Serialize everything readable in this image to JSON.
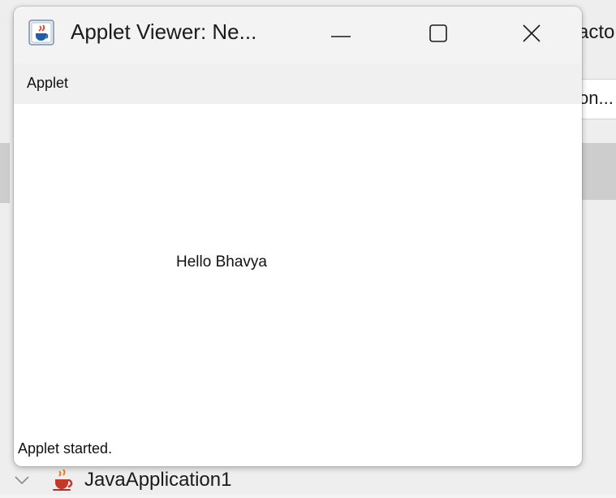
{
  "background": {
    "partial_label": "acto",
    "partial_button": "on...",
    "tree_item": "JavaApplication1"
  },
  "window": {
    "title": "Applet Viewer: Ne...",
    "controls": {
      "minimize": "minimize-icon",
      "maximize": "maximize-icon",
      "close": "close-icon"
    }
  },
  "menubar": {
    "items": [
      {
        "label": "Applet"
      }
    ]
  },
  "canvas": {
    "text": "Hello Bhavya"
  },
  "statusbar": {
    "text": "Applet started."
  }
}
